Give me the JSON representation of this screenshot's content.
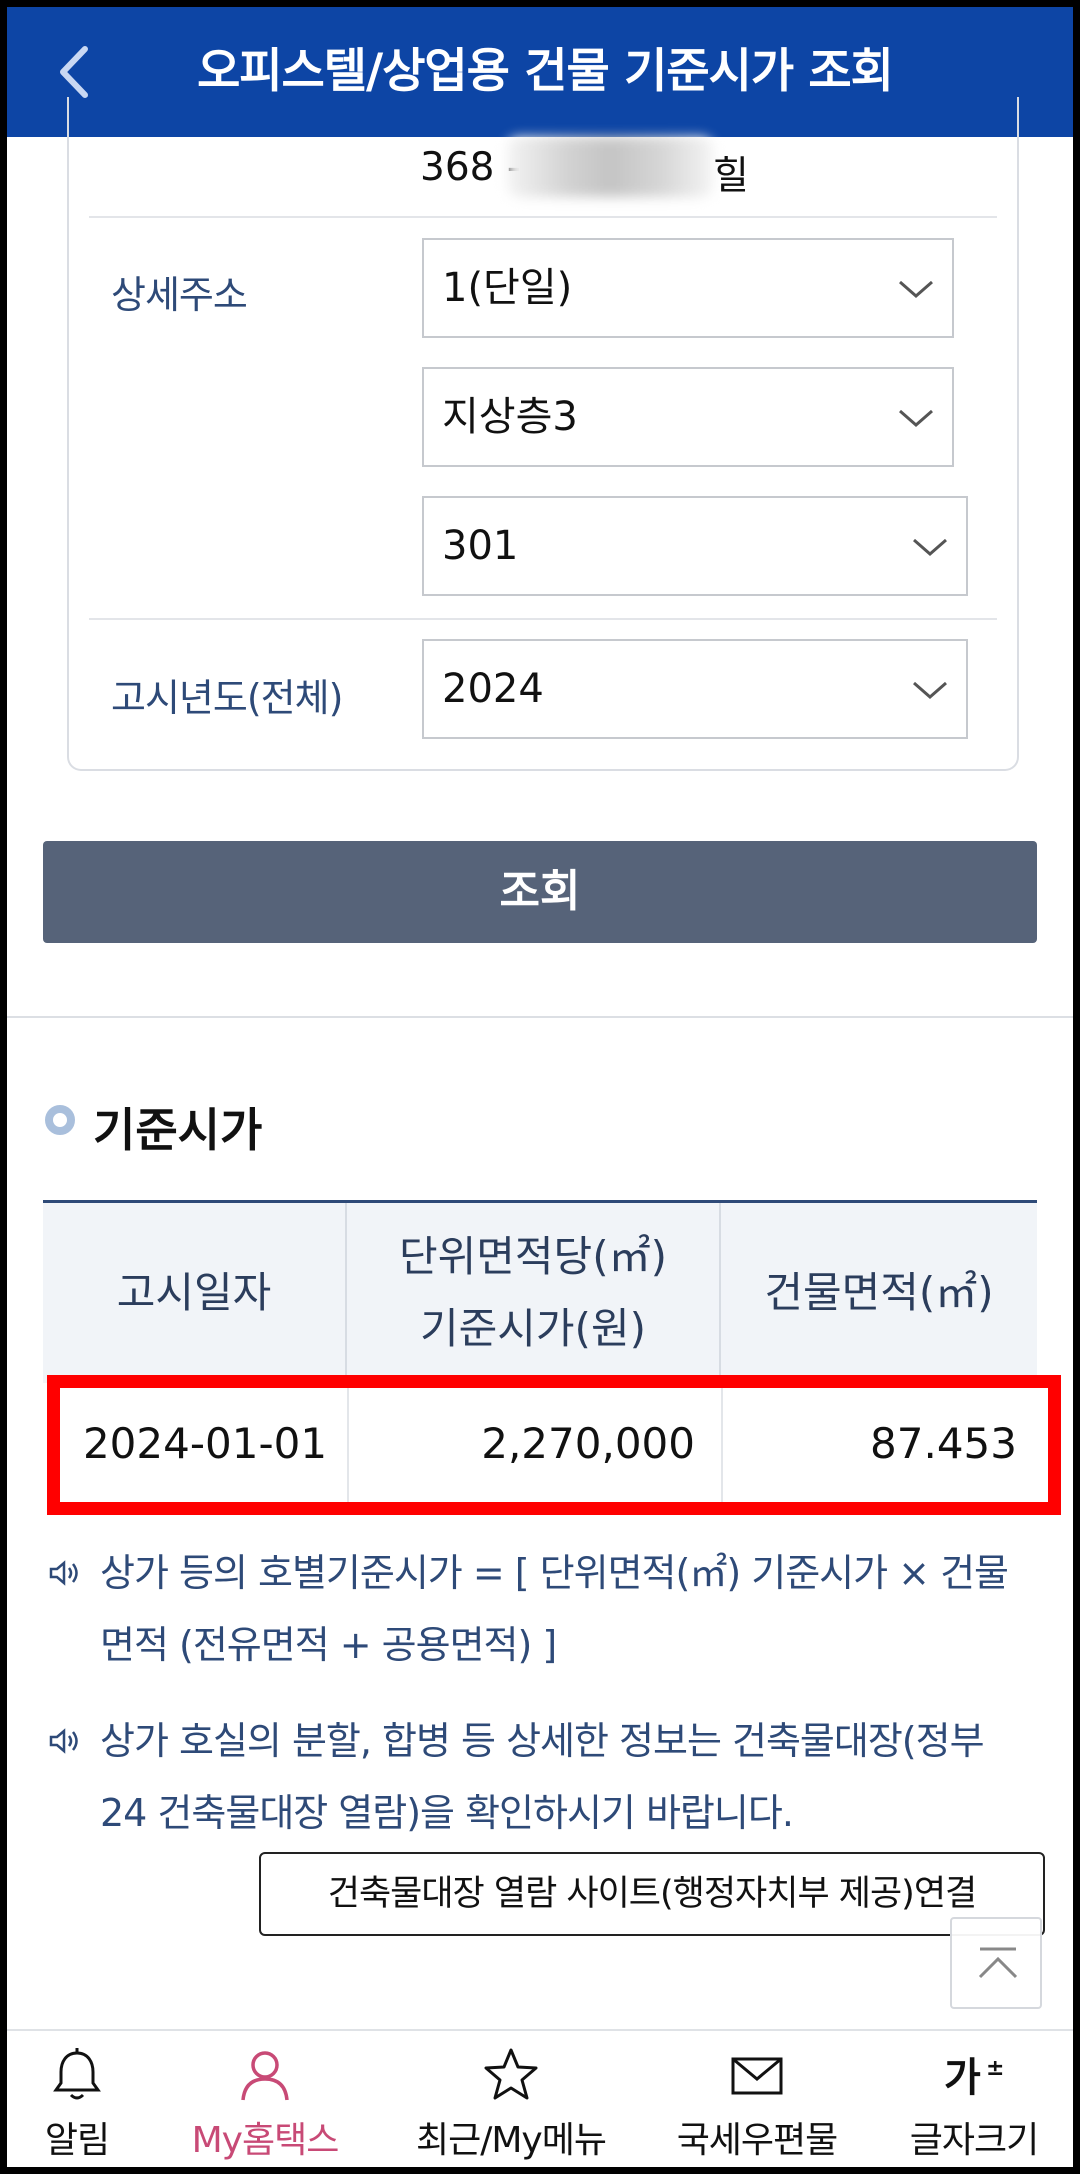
{
  "header": {
    "title": "오피스텔/상업용 건물 기준시가 조회"
  },
  "form": {
    "address_line": {
      "prefix": "368 -",
      "suffix": "힐"
    },
    "detail_label": "상세주소",
    "detail_selects": [
      "1(단일)",
      "지상층3",
      "301"
    ],
    "year_label": "고시년도(전체)",
    "year_value": "2024"
  },
  "search_button": "조회",
  "section_title": "기준시가",
  "table": {
    "headers": [
      {
        "line1": "고시일자",
        "line2": ""
      },
      {
        "line1": "단위면적당(㎡)",
        "line2": "기준시가(원)"
      },
      {
        "line1": "건물면적(㎡)",
        "line2": ""
      }
    ],
    "rows": [
      {
        "date": "2024-01-01",
        "unit_price": "2,270,000",
        "area": "87.453"
      }
    ]
  },
  "notes": [
    {
      "line1": "상가 등의 호별기준시가 = [ 단위면적(㎡) 기준시가 × 건물",
      "line2": "면적 (전유면적 + 공용면적) ]"
    },
    {
      "line1": "상가 호실의 분할, 합병 등 상세한 정보는 건축물대장(정부",
      "line2": "24 건축물대장 열람)을 확인하시기 바랍니다."
    }
  ],
  "link_button": "건축물대장 열람 사이트(행정자치부 제공)연결",
  "bottom_nav": [
    {
      "label": "알림",
      "icon": "bell-icon"
    },
    {
      "label": "My홈택스",
      "icon": "person-icon"
    },
    {
      "label": "최근/My메뉴",
      "icon": "star-icon"
    },
    {
      "label": "국세우편물",
      "icon": "mail-icon"
    },
    {
      "label": "글자크기",
      "icon": "font-size-icon"
    }
  ],
  "colors": {
    "header_bg": "#0d45a5",
    "button_bg": "#566379",
    "label_text": "#2e4a78",
    "active_nav": "#c84a76",
    "highlight": "#ff0000"
  }
}
